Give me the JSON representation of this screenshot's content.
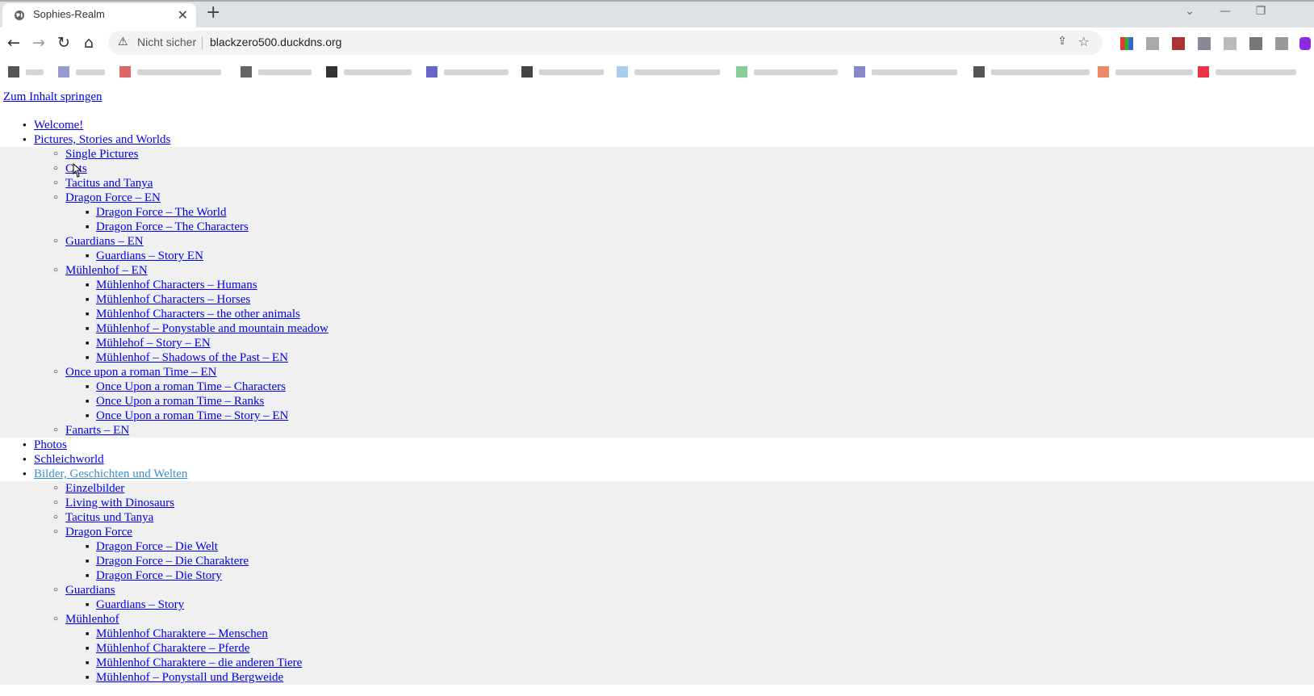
{
  "browser": {
    "tab_title": "Sophies-Realm",
    "tab_close": "✕",
    "new_tab": "+",
    "window_controls": [
      "⌄",
      "—",
      "❐"
    ],
    "security_label": "Nicht sicher",
    "warning_icon": "⚠",
    "url": "blackzero500.duckdns.org",
    "nav": {
      "back": "←",
      "forward": "→",
      "reload": "↻",
      "home": "⌂"
    },
    "share_icon": "⇪",
    "star_icon": "☆"
  },
  "page": {
    "skip_link": "Zum Inhalt springen",
    "menu_en": [
      {
        "label": "Welcome!"
      },
      {
        "label": "Pictures, Stories and Worlds",
        "children": [
          {
            "label": "Single Pictures"
          },
          {
            "label": "Cats"
          },
          {
            "label": "Tacitus and Tanya"
          },
          {
            "label": "Dragon Force – EN",
            "children": [
              {
                "label": "Dragon Force – The World"
              },
              {
                "label": "Dragon Force – The Characters"
              }
            ]
          },
          {
            "label": "Guardians – EN",
            "children": [
              {
                "label": "Guardians – Story EN"
              }
            ]
          },
          {
            "label": "Mühlenhof – EN",
            "children": [
              {
                "label": "Mühlenhof Characters – Humans"
              },
              {
                "label": "Mühlenhof Characters – Horses"
              },
              {
                "label": "Mühlenhof Characters – the other animals"
              },
              {
                "label": "Mühlenhof – Ponystable and mountain meadow"
              },
              {
                "label": "Mühlehof – Story – EN"
              },
              {
                "label": "Mühlenhof – Shadows of the Past – EN"
              }
            ]
          },
          {
            "label": "Once upon a roman Time – EN",
            "children": [
              {
                "label": "Once Upon a roman Time – Characters"
              },
              {
                "label": "Once Upon a roman Time – Ranks"
              },
              {
                "label": "Once Upon a roman Time – Story – EN"
              }
            ]
          },
          {
            "label": "Fanarts – EN"
          }
        ]
      },
      {
        "label": "Photos"
      },
      {
        "label": "Schleichworld"
      }
    ],
    "menu_de": [
      {
        "label": "Bilder, Geschichten und Welten",
        "children": [
          {
            "label": "Einzelbilder"
          },
          {
            "label": "Living with Dinosaurs"
          },
          {
            "label": "Tacitus und Tanya"
          },
          {
            "label": "Dragon Force",
            "children": [
              {
                "label": "Dragon Force – Die Welt"
              },
              {
                "label": "Dragon Force – Die Charaktere"
              },
              {
                "label": "Dragon Force – Die Story"
              }
            ]
          },
          {
            "label": "Guardians",
            "children": [
              {
                "label": "Guardians – Story"
              }
            ]
          },
          {
            "label": "Mühlenhof",
            "children": [
              {
                "label": "Mühlenhof Charaktere – Menschen"
              },
              {
                "label": "Mühlenhof Charaktere – Pferde"
              },
              {
                "label": "Mühlenhof Charaktere – die anderen Tiere"
              },
              {
                "label": "Mühlenhof – Ponystall und Bergweide"
              }
            ]
          }
        ]
      }
    ]
  },
  "colors": {
    "link": "#0000ee",
    "hover_link": "#3a8fd0",
    "submenu_bg": "#f0f0f0"
  }
}
